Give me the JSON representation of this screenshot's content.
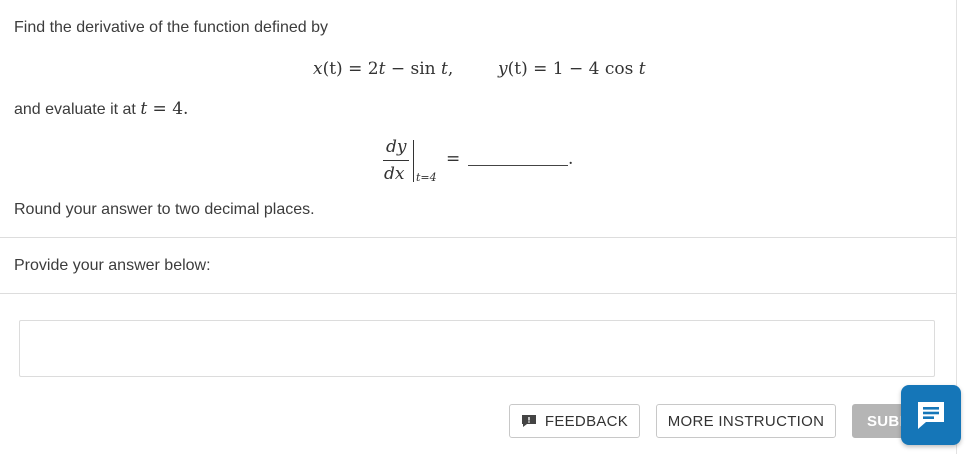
{
  "question": {
    "intro": "Find the derivative of the function defined by",
    "x_eq": {
      "lhs": "x",
      "arg": "(t)",
      "eq": " = 2",
      "t1": "t",
      "minus": " − sin ",
      "t2": "t",
      "comma": ","
    },
    "y_eq": {
      "lhs": "y",
      "arg": "(t)",
      "eq": " = 1 − 4 cos ",
      "t1": "t"
    },
    "evaluate_prefix": "and evaluate it at ",
    "evaluate_var": "t",
    "evaluate_value": " = 4.",
    "deriv": {
      "num": "dy",
      "den": "dx",
      "sub": "t=4",
      "equals": "=",
      "period": "."
    },
    "rounding": "Round your answer to two decimal places."
  },
  "answer_prompt": "Provide your answer below:",
  "buttons": {
    "feedback": "FEEDBACK",
    "more_instruction": "MORE INSTRUCTION",
    "submit": "SUBMIT"
  },
  "colors": {
    "chat_button": "#1576b8",
    "submit_bg": "#b5b5b5"
  }
}
